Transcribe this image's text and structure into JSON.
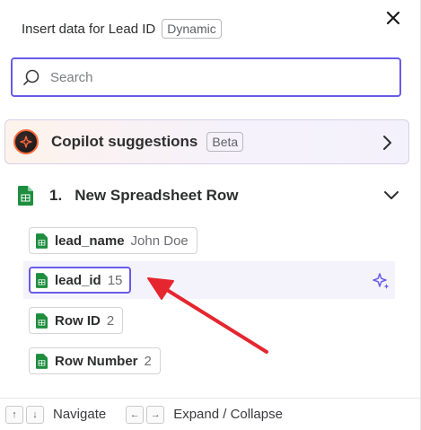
{
  "header": {
    "title": "Insert data for Lead ID",
    "badge": "Dynamic"
  },
  "search": {
    "placeholder": "Search",
    "value": ""
  },
  "copilot": {
    "label": "Copilot suggestions",
    "badge": "Beta"
  },
  "step": {
    "number": "1.",
    "title": "New Spreadsheet Row",
    "fields": [
      {
        "key": "lead_name",
        "value": "John Doe",
        "selected": false
      },
      {
        "key": "lead_id",
        "value": "15",
        "selected": true
      },
      {
        "key": "Row ID",
        "value": "2",
        "selected": false
      },
      {
        "key": "Row Number",
        "value": "2",
        "selected": false
      }
    ]
  },
  "footer": {
    "navigate_up_key": "↑",
    "navigate_down_key": "↓",
    "navigate_label": "Navigate",
    "collapse_left_key": "←",
    "expand_right_key": "→",
    "expand_label": "Expand / Collapse"
  },
  "colors": {
    "accent": "#695be8",
    "sheets_green": "#1e8e3e",
    "annotation_arrow": "#e5262f"
  },
  "icons": {
    "close": "close-icon",
    "search": "search-icon",
    "copilot": "copilot-sparkle-icon",
    "sheets": "google-sheets-icon",
    "sparkle_action": "ai-sparkle-icon"
  }
}
